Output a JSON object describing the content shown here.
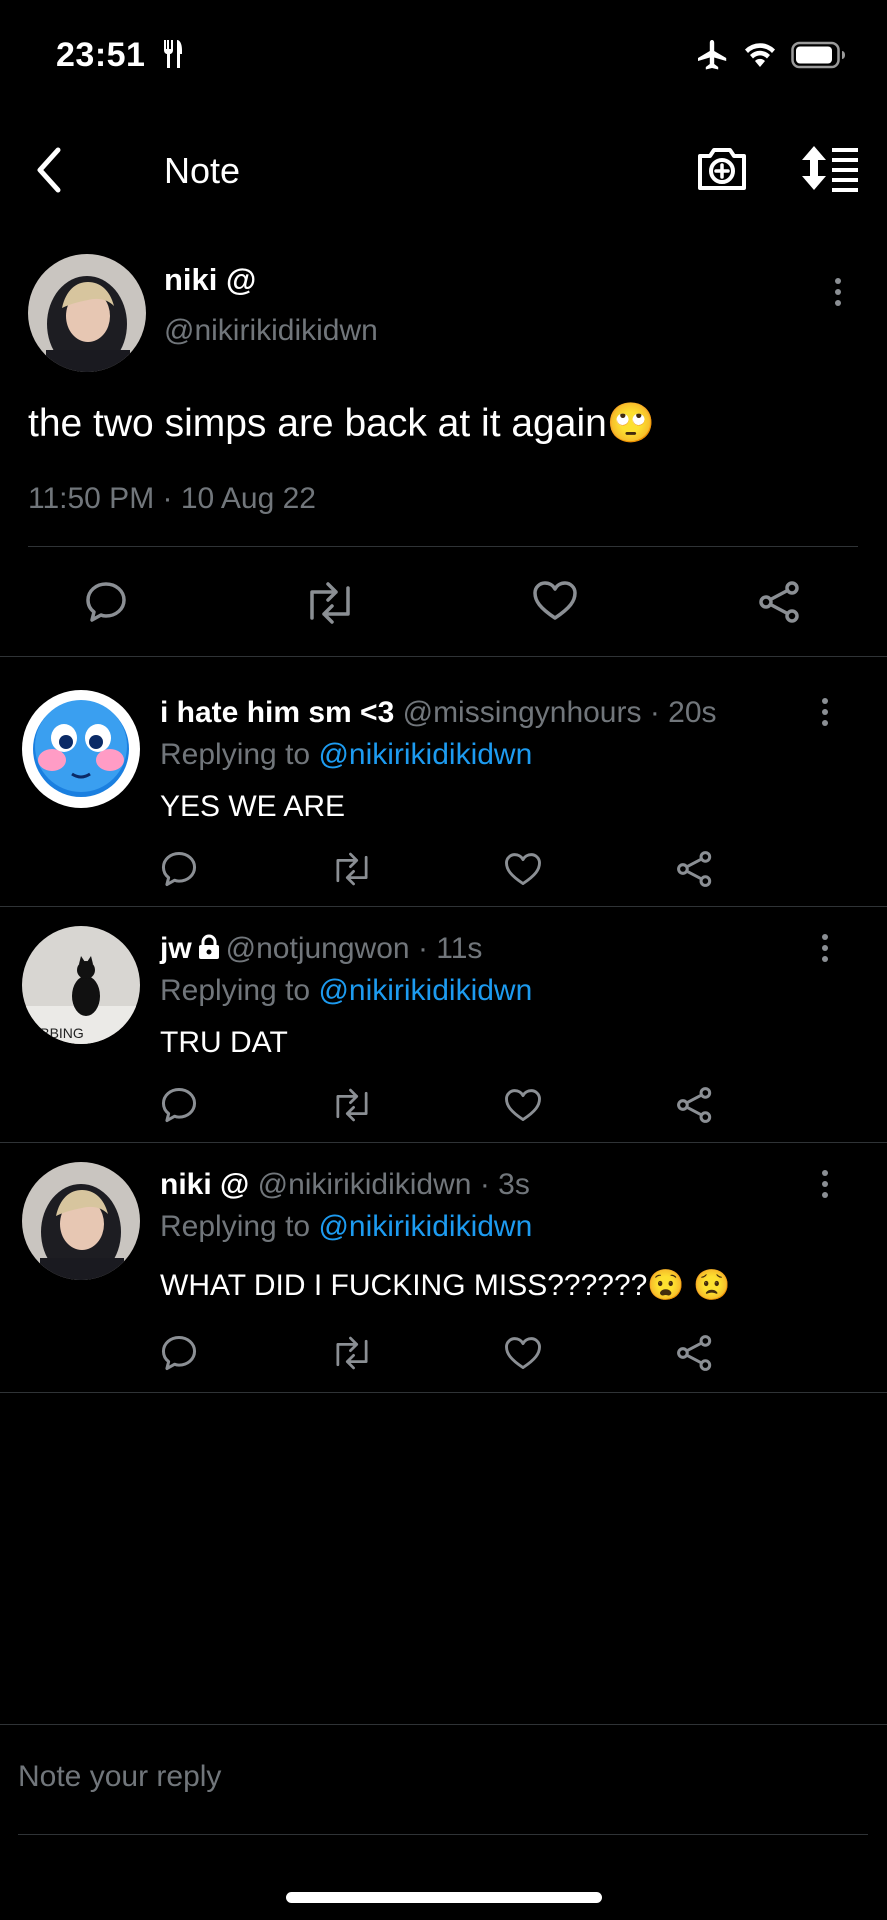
{
  "status": {
    "time": "23:51"
  },
  "nav": {
    "title": "Note"
  },
  "main_post": {
    "name": "niki @",
    "handle": "@nikirikidikidwn",
    "text": "the two simps are back at it again",
    "emoji": "🙄",
    "timestamp": "11:50 PM · 10 Aug 22"
  },
  "replies": [
    {
      "name": "i hate him sm <3",
      "handle": "@missingynhours",
      "time": "· 20s",
      "replying_prefix": "Replying to ",
      "mention": "@nikirikidikidwn",
      "text": "YES WE ARE"
    },
    {
      "name": "jw",
      "handle": "@notjungwon",
      "time": "· 11s",
      "replying_prefix": "Replying to ",
      "mention": "@nikirikidikidwn",
      "text": "TRU DAT",
      "avatar_caption": "SOBBING"
    },
    {
      "name": "niki @",
      "handle": "@nikirikidikidwn",
      "time": "· 3s",
      "replying_prefix": "Replying to ",
      "mention": "@nikirikidikidwn",
      "text": "WHAT DID I FUCKING MISS??????",
      "emoji": "😧 😟"
    }
  ],
  "compose": {
    "placeholder": "Note your reply"
  },
  "colors": {
    "background": "#000000",
    "muted": "#71767b",
    "link": "#1d9bf0",
    "divider": "#2f3336"
  },
  "icons": [
    "fork-knife-icon",
    "airplane-icon",
    "wifi-icon",
    "battery-icon",
    "back-chevron-icon",
    "camera-plus-icon",
    "sort-icon",
    "reply-icon",
    "retweet-icon",
    "like-icon",
    "share-icon",
    "more-icon",
    "lock-icon"
  ]
}
